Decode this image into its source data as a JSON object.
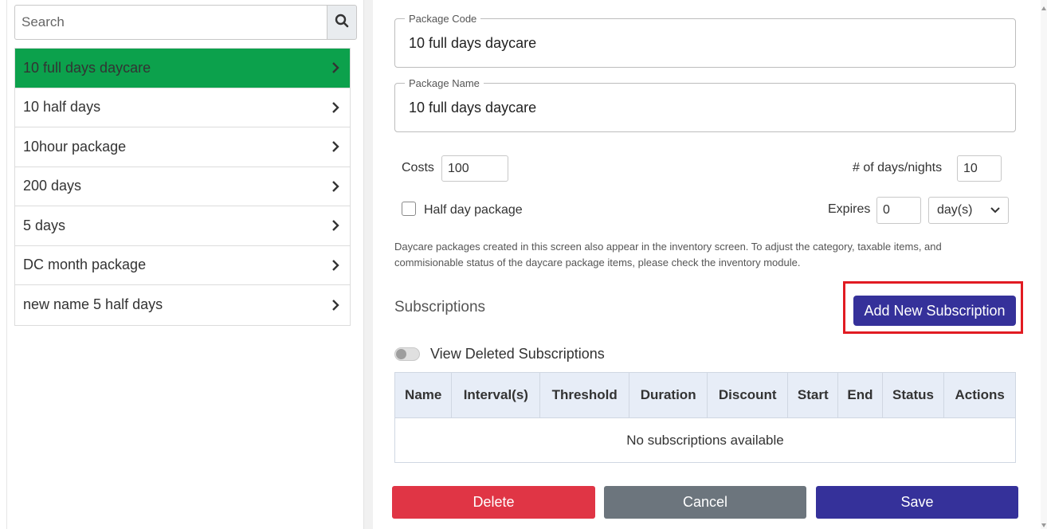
{
  "sidebar": {
    "search_placeholder": "Search",
    "items": [
      {
        "label": "10 full days daycare",
        "active": true
      },
      {
        "label": "10 half days",
        "active": false
      },
      {
        "label": "10hour package",
        "active": false
      },
      {
        "label": "200 days",
        "active": false
      },
      {
        "label": "5 days",
        "active": false
      },
      {
        "label": "DC month package",
        "active": false
      },
      {
        "label": "new name 5 half days",
        "active": false
      }
    ]
  },
  "form": {
    "package_code_label": "Package Code",
    "package_code_value": "10 full days daycare",
    "package_name_label": "Package Name",
    "package_name_value": "10 full days daycare",
    "costs_label": "Costs",
    "costs_value": "100",
    "days_nights_label": "# of days/nights",
    "days_nights_value": "10",
    "half_day_label": "Half day package",
    "half_day_checked": false,
    "expires_label": "Expires",
    "expires_value": "0",
    "expires_unit": "day(s)",
    "info_text": "Daycare packages created in this screen also appear in the inventory screen. To adjust the category, taxable items, and commisionable status of the daycare package items, please check the inventory module."
  },
  "subscriptions": {
    "title": "Subscriptions",
    "add_button": "Add New Subscription",
    "view_deleted_label": "View Deleted Subscriptions",
    "view_deleted_on": false,
    "columns": [
      "Name",
      "Interval(s)",
      "Threshold",
      "Duration",
      "Discount",
      "Start",
      "End",
      "Status",
      "Actions"
    ],
    "empty_text": "No subscriptions available"
  },
  "actions": {
    "delete": "Delete",
    "cancel": "Cancel",
    "save": "Save"
  },
  "colors": {
    "active_item": "#0ca14c",
    "primary": "#35319a",
    "danger": "#e03545",
    "secondary": "#6c757d",
    "highlight": "#e11b22"
  },
  "icons": {
    "search": "search-icon",
    "chevron": "chevron-right-icon",
    "select_arrow": "chevron-down-icon"
  }
}
